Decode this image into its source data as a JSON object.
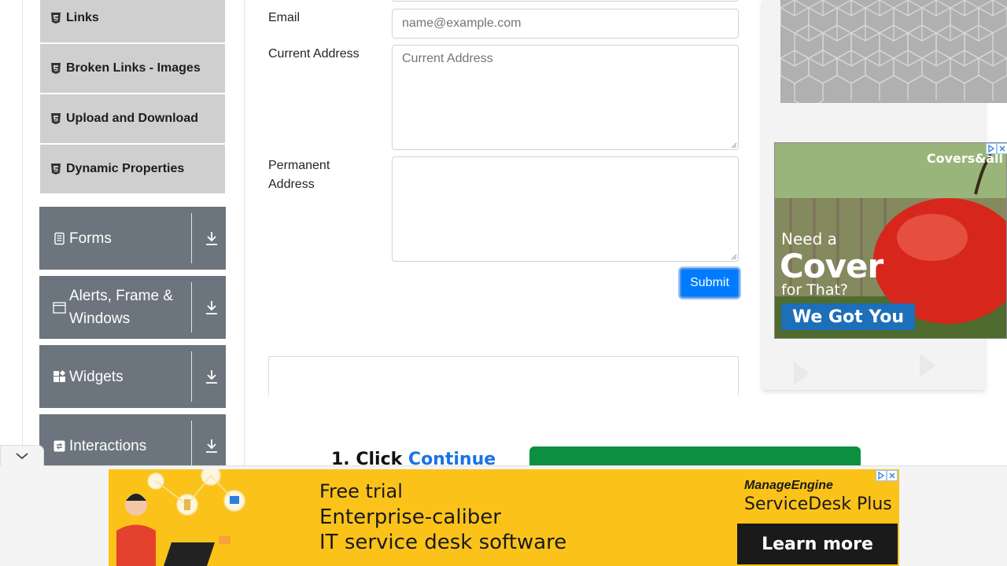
{
  "sidebar": {
    "sub_items": [
      {
        "label": "Links",
        "icon": "html5-icon"
      },
      {
        "label": "Broken Links - Images",
        "icon": "html5-icon"
      },
      {
        "label": "Upload and Download",
        "icon": "html5-icon"
      },
      {
        "label": "Dynamic Properties",
        "icon": "html5-icon"
      }
    ],
    "groups": [
      {
        "label": "Forms",
        "icon": "list-icon"
      },
      {
        "label": "Alerts, Frame & Windows",
        "icon": "window-icon"
      },
      {
        "label": "Widgets",
        "icon": "widgets-icon"
      },
      {
        "label": "Interactions",
        "icon": "interactions-icon"
      }
    ]
  },
  "form": {
    "email_label": "Email",
    "email_placeholder": "name@example.com",
    "current_address_label": "Current Address",
    "current_address_placeholder": "Current Address",
    "permanent_address_label": "Permanent Address",
    "permanent_address_placeholder": "",
    "submit_label": "Submit"
  },
  "content": {
    "step_number": "1.",
    "step_text": "Click",
    "step_link": "Continue"
  },
  "side_ad": {
    "brand": "Covers&all",
    "line1": "Need a",
    "line2": "Cover",
    "line3": "for That?",
    "cta": "We Got You"
  },
  "bottom_ad": {
    "line1": "Free trial",
    "line2": "Enterprise-caliber",
    "line3": "IT service desk software",
    "vendor": "ManageEngine",
    "product": "ServiceDesk Plus",
    "cta": "Learn more"
  },
  "colors": {
    "accent": "#007bff",
    "sidebar_group_bg": "#6c757d",
    "sidebar_item_bg": "#cfcfcf",
    "banner_bg": "#fbc31a",
    "green_button": "#0a9040"
  }
}
